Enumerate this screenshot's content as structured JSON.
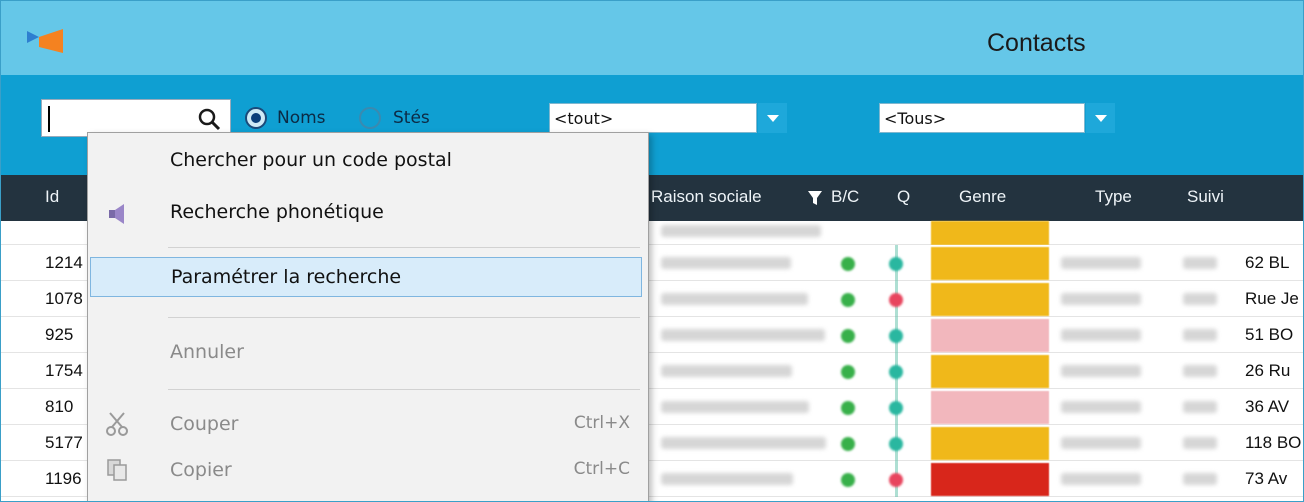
{
  "window": {
    "title": "Contacts"
  },
  "toolbar": {
    "search": {
      "value": ""
    },
    "radio_noms": "Noms",
    "radio_stes": "Stés",
    "combo1": "<tout>",
    "combo2": "<Tous>"
  },
  "grid": {
    "columns": [
      "Id",
      "Raison sociale",
      "B/C",
      "Q",
      "Genre",
      "Type",
      "Suivi"
    ],
    "rows": [
      {
        "id": "1214",
        "addr": "62 BL",
        "q_color": "#2ab7a0",
        "genre_color": "#f0b81a"
      },
      {
        "id": "1078",
        "addr": "Rue Je",
        "q_color": "#e8455e",
        "genre_color": "#f0b81a"
      },
      {
        "id": "925",
        "addr": "51 BO",
        "q_color": "#2ab7a0",
        "genre_color": "#f2b7bd"
      },
      {
        "id": "1754",
        "addr": "26 Ru",
        "q_color": "#2ab7a0",
        "genre_color": "#f0b81a"
      },
      {
        "id": "810",
        "addr": "36 AV",
        "q_color": "#2ab7a0",
        "genre_color": "#f2b7bd"
      },
      {
        "id": "5177",
        "addr": "118 BO",
        "q_color": "#2ab7a0",
        "genre_color": "#f0b81a"
      },
      {
        "id": "1196",
        "addr": "73 Av",
        "q_color": "#e8455e",
        "genre_color": "#d8261b"
      }
    ]
  },
  "context_menu": {
    "items": [
      {
        "label": "Chercher pour un code postal",
        "shortcut": "",
        "disabled": false,
        "highlighted": false,
        "icon": ""
      },
      {
        "label": "Recherche phonétique",
        "shortcut": "",
        "disabled": false,
        "highlighted": false,
        "icon": "speaker-icon"
      },
      {
        "label": "Paramétrer la recherche",
        "shortcut": "",
        "disabled": false,
        "highlighted": true,
        "icon": ""
      },
      {
        "label": "Annuler",
        "shortcut": "",
        "disabled": true,
        "highlighted": false,
        "icon": ""
      },
      {
        "label": "Couper",
        "shortcut": "Ctrl+X",
        "disabled": true,
        "highlighted": false,
        "icon": "scissors-icon"
      },
      {
        "label": "Copier",
        "shortcut": "Ctrl+C",
        "disabled": true,
        "highlighted": false,
        "icon": "copy-icon"
      }
    ]
  },
  "colors": {
    "titlebar": "#65c7e8",
    "toolbar": "#0f9fd2",
    "grid_header": "#23333f",
    "menu_highlight": "#d8ecfa",
    "status_green": "#38b04a"
  }
}
